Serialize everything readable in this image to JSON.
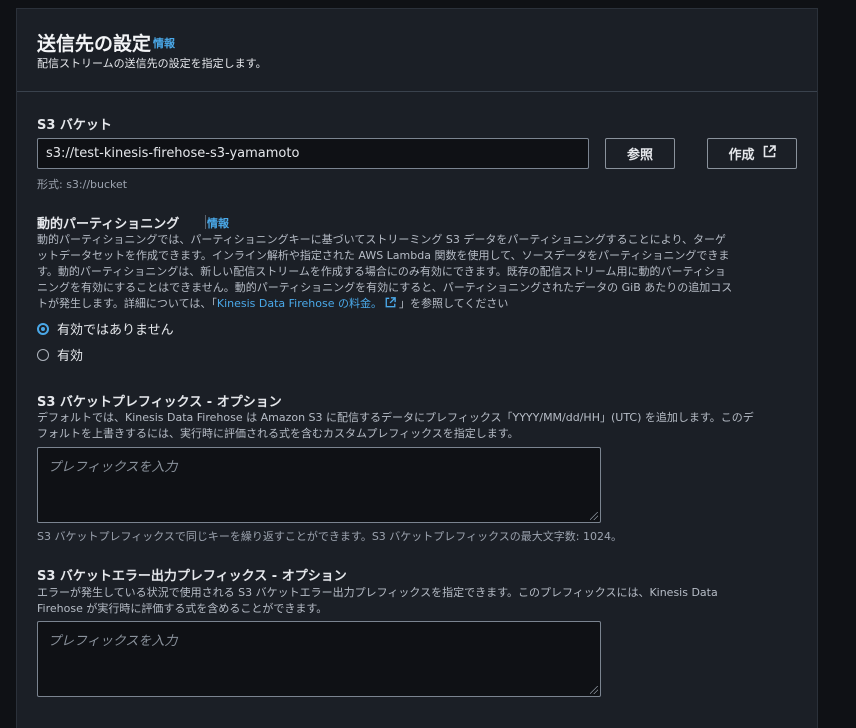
{
  "header": {
    "title": "送信先の設定",
    "info": "情報",
    "subtitle": "配信ストリームの送信先の設定を指定します。"
  },
  "s3_bucket": {
    "label": "S3 バケット",
    "value": "s3://test-kinesis-firehose-s3-yamamoto",
    "browse_label": "参照",
    "create_label": "作成",
    "format_hint": "形式: s3://bucket"
  },
  "dynamic_partitioning": {
    "label": "動的パーティショニング",
    "info": "情報",
    "description_lines": [
      "動的パーティショニングでは、パーティショニングキーに基づいてストリーミング S3 データをパーティショニングすることにより、ターゲ",
      "ットデータセットを作成できます。インライン解析や指定された AWS Lambda 関数を使用して、ソースデータをパーティショニングできま",
      "す。動的パーティショニングは、新しい配信ストリームを作成する場合にのみ有効にできます。既存の配信ストリーム用に動的パーティショ",
      "ニングを有効にすることはできません。動的パーティショニングを有効にすると、パーティショニングされたデータの GiB あたりの追加コス"
    ],
    "description_last_prefix": "トが発生します。詳細については、「",
    "description_link": "Kinesis Data Firehose の料金。",
    "description_last_suffix": "」を参照してください",
    "options": [
      {
        "label": "有効ではありません",
        "selected": true
      },
      {
        "label": "有効",
        "selected": false
      }
    ]
  },
  "prefix": {
    "label": "S3 バケットプレフィックス - オプション",
    "description_lines": [
      "デフォルトでは、Kinesis Data Firehose は Amazon S3 に配信するデータにプレフィックス「YYYY/MM/dd/HH」(UTC) を追加します。このデ",
      "フォルトを上書きするには、実行時に評価される式を含むカスタムプレフィックスを指定します。"
    ],
    "placeholder": "プレフィックスを入力",
    "hint": "S3 バケットプレフィックスで同じキーを繰り返すことができます。S3 バケットプレフィックスの最大文字数: 1024。"
  },
  "error_prefix": {
    "label": "S3 バケットエラー出力プレフィックス - オプション",
    "description_lines": [
      "エラーが発生している状況で使用される S3 バケットエラー出力プレフィックスを指定できます。このプレフィックスには、Kinesis Data",
      "Firehose が実行時に評価する式を含めることができます。"
    ],
    "placeholder": "プレフィックスを入力"
  },
  "colors": {
    "link": "#4aa8e8",
    "panel_bg": "#1b1f26",
    "page_bg": "#0f1115"
  }
}
